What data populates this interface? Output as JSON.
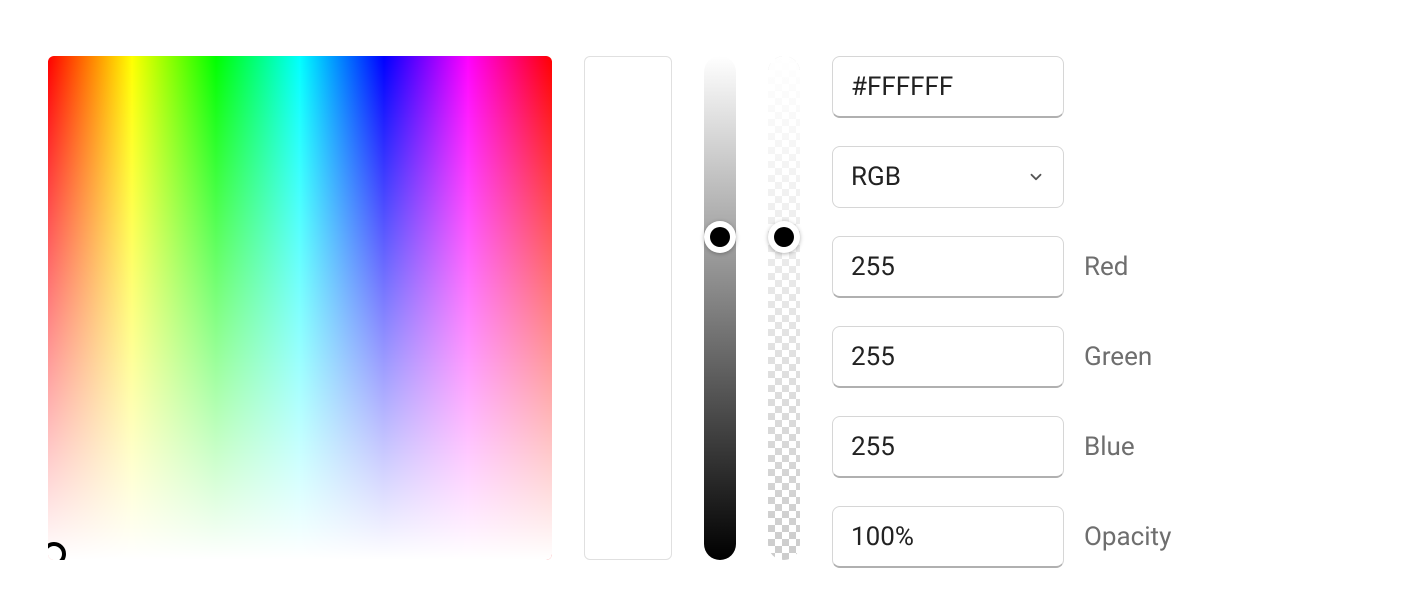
{
  "hex": "#FFFFFF",
  "colorFormat": {
    "selected": "RGB"
  },
  "channels": {
    "red": {
      "label": "Red",
      "value": "255"
    },
    "green": {
      "label": "Green",
      "value": "255"
    },
    "blue": {
      "label": "Blue",
      "value": "255"
    }
  },
  "opacity": {
    "label": "Opacity",
    "value": "100%"
  }
}
